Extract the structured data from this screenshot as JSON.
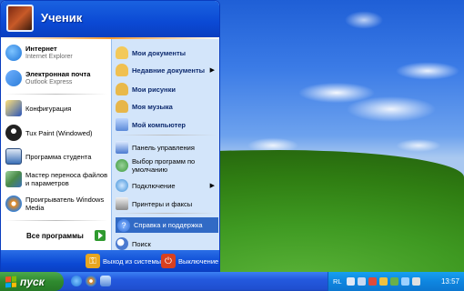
{
  "user": {
    "name": "Ученик"
  },
  "pinned": [
    {
      "title": "Интернет",
      "subtitle": "Internet Explorer",
      "icon": "internet-explorer-icon",
      "color": "#1d74d8"
    },
    {
      "title": "Электронная почта",
      "subtitle": "Outlook Express",
      "icon": "outlook-express-icon",
      "color": "#2f7fd9"
    }
  ],
  "recent": [
    {
      "label": "Конфигурация",
      "icon": "configuration-icon",
      "color": "#2a55b8"
    },
    {
      "label": "Tux Paint (Windowed)",
      "icon": "tux-paint-icon",
      "color": "#222222"
    },
    {
      "label": "Программа студента",
      "icon": "student-program-icon",
      "color": "#3a6fb6"
    },
    {
      "label": "Мастер переноса файлов и параметров",
      "icon": "transfer-wizard-icon",
      "color": "#4a8a4a"
    },
    {
      "label": "Проигрыватель Windows Media",
      "icon": "windows-media-player-icon",
      "color": "#e98a1c"
    }
  ],
  "all_programs": {
    "label": "Все программы",
    "arrow_color": "#2f9a2f"
  },
  "places": [
    {
      "label": "Мои документы",
      "bold": true,
      "arrow": false,
      "icon": "my-documents-icon",
      "color": "#f3c95a"
    },
    {
      "label": "Недавние документы",
      "bold": true,
      "arrow": true,
      "icon": "recent-documents-icon",
      "color": "#f0c050"
    },
    {
      "label": "Мои рисунки",
      "bold": true,
      "arrow": false,
      "icon": "my-pictures-icon",
      "color": "#e9b94a"
    },
    {
      "label": "Моя музыка",
      "bold": true,
      "arrow": false,
      "icon": "my-music-icon",
      "color": "#e7b64a"
    },
    {
      "label": "Мой компьютер",
      "bold": true,
      "arrow": false,
      "icon": "my-computer-icon",
      "color": "#5a8ad8"
    },
    {
      "label": "Панель управления",
      "bold": false,
      "arrow": false,
      "icon": "control-panel-icon",
      "color": "#4a7ad0"
    },
    {
      "label": "Выбор программ по умолчанию",
      "bold": false,
      "arrow": false,
      "icon": "default-programs-icon",
      "color": "#3a9a3a"
    },
    {
      "label": "Подключение",
      "bold": false,
      "arrow": true,
      "icon": "connect-icon",
      "color": "#3b8fd8"
    },
    {
      "label": "Принтеры и факсы",
      "bold": false,
      "arrow": false,
      "icon": "printers-icon",
      "color": "#8a8a8a"
    },
    {
      "label": "Справка и поддержка",
      "bold": false,
      "arrow": false,
      "icon": "help-icon",
      "color": "#2a6ad8",
      "selected": true
    },
    {
      "label": "Поиск",
      "bold": false,
      "arrow": false,
      "icon": "search-icon",
      "color": "#4a7ad0"
    }
  ],
  "footer": {
    "logoff": {
      "label": "Выход из системы",
      "icon": "logoff-icon",
      "color": "#e8a620"
    },
    "shutdown": {
      "label": "Выключение",
      "icon": "shutdown-icon",
      "color": "#d8401f"
    }
  },
  "taskbar": {
    "start_label": "пуск",
    "lang": "RL",
    "clock": "13:57"
  }
}
